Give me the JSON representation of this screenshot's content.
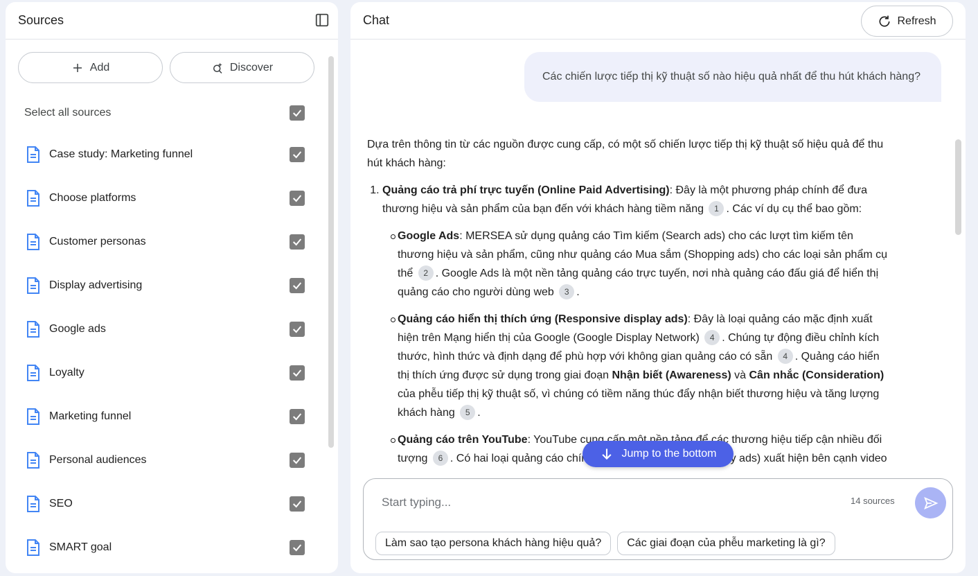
{
  "sources_panel": {
    "title": "Sources",
    "add_label": "Add",
    "discover_label": "Discover",
    "select_all_label": "Select all sources",
    "items": [
      {
        "label": "Case study: Marketing funnel"
      },
      {
        "label": "Choose platforms"
      },
      {
        "label": "Customer personas"
      },
      {
        "label": "Display advertising"
      },
      {
        "label": "Google ads"
      },
      {
        "label": "Loyalty"
      },
      {
        "label": "Marketing funnel"
      },
      {
        "label": "Personal audiences"
      },
      {
        "label": "SEO"
      },
      {
        "label": "SMART goal"
      }
    ]
  },
  "chat_panel": {
    "title": "Chat",
    "refresh_label": "Refresh",
    "user_message": "Các chiến lược tiếp thị kỹ thuật số nào hiệu quả nhất để thu hút khách hàng?",
    "answer": {
      "intro": "Dựa trên thông tin từ các nguồn được cung cấp, có một số chiến lược tiếp thị kỹ thuật số hiệu quả để thu hút khách hàng:",
      "item1_title": "Quảng cáo trả phí trực tuyến (Online Paid Advertising)",
      "item1_text_a": ": Đây là một phương pháp chính để đưa thương hiệu và sản phẩm của bạn đến với khách hàng tiềm năng",
      "item1_text_b": ". Các ví dụ cụ thể bao gồm:",
      "sub1_title": "Google Ads",
      "sub1_text_a": ": MERSEA sử dụng quảng cáo Tìm kiếm (Search ads) cho các lượt tìm kiếm tên thương hiệu và sản phẩm, cũng như quảng cáo Mua sắm (Shopping ads) cho các loại sản phẩm cụ thể",
      "sub1_text_b": ". Google Ads là một nền tảng quảng cáo trực tuyến, nơi nhà quảng cáo đấu giá để hiển thị quảng cáo cho người dùng web",
      "sub1_text_c": ".",
      "sub2_title": "Quảng cáo hiển thị thích ứng (Responsive display ads)",
      "sub2_text_a": ": Đây là loại quảng cáo mặc định xuất hiện trên Mạng hiển thị của Google (Google Display Network)",
      "sub2_text_b": ". Chúng tự động điều chỉnh kích thước, hình thức và định dạng để phù hợp với không gian quảng cáo có sẵn",
      "sub2_text_c": ". Quảng cáo hiển thị thích ứng được sử dụng trong giai đoạn",
      "sub2_bold_a": "Nhận biết (Awareness)",
      "sub2_and": "và",
      "sub2_bold_b": "Cân nhắc (Consideration)",
      "sub2_text_d": "của phễu tiếp thị kỹ thuật số, vì chúng có tiềm năng thúc đẩy nhận biết thương hiệu và tăng lượng khách hàng",
      "sub2_text_e": ".",
      "sub3_title": "Quảng cáo trên YouTube",
      "sub3_text_a": ": YouTube cung cấp một nền tảng để các thương hiệu tiếp cận nhiều đối tượng",
      "sub3_text_b": ". Có hai loại quảng cáo chính: Quảng cáo hiển thị (Display ads) xuất hiện bên cạnh video",
      "citations": {
        "c1": "1",
        "c2": "2",
        "c3": "3",
        "c4": "4",
        "c5": "5",
        "c6": "6"
      }
    },
    "jump_label": "Jump to the bottom",
    "composer": {
      "placeholder": "Start typing...",
      "source_count": "14 sources",
      "suggestions": [
        {
          "label": "Làm sao tạo persona khách hàng hiệu quả?"
        },
        {
          "label": "Các giai đoạn của phễu marketing là gì?"
        }
      ]
    }
  },
  "colors": {
    "background": "#eef1f8",
    "accent": "#4c61e6",
    "send_button": "#aab4f5",
    "checkbox": "#7c7c7c",
    "doc_icon": "#4285f4"
  },
  "icons": {
    "collapse": "panel-collapse-icon",
    "add": "plus-icon",
    "discover": "sparkle-search-icon",
    "source": "document-icon",
    "refresh": "refresh-icon",
    "jump": "arrow-down-icon",
    "send": "send-icon"
  }
}
